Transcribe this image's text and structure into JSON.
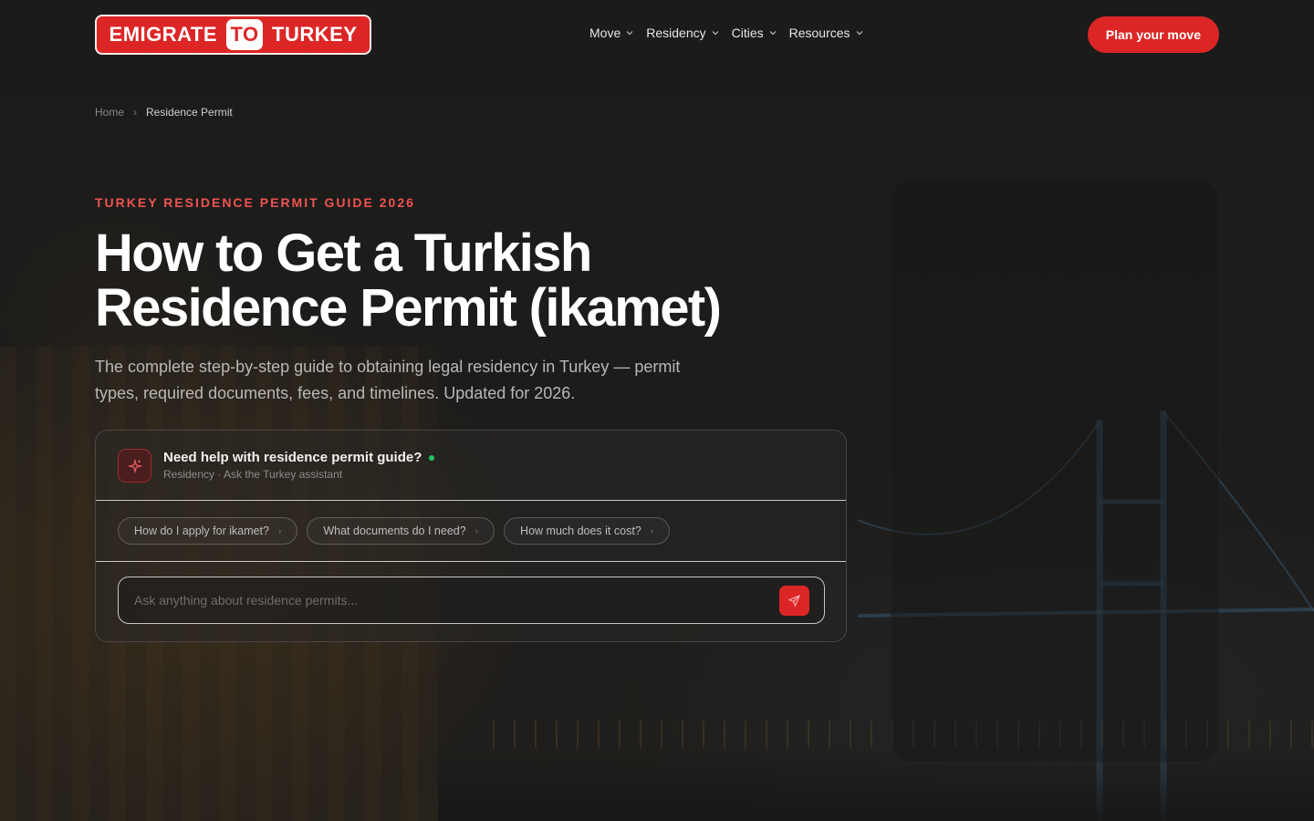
{
  "brand": {
    "left": "EMIGRATE",
    "middle": "TO",
    "right": "TURKEY"
  },
  "nav": {
    "items": [
      {
        "label": "Move"
      },
      {
        "label": "Residency"
      },
      {
        "label": "Cities"
      },
      {
        "label": "Resources"
      }
    ],
    "cta": "Plan your move"
  },
  "breadcrumb": {
    "home": "Home",
    "current": "Residence Permit"
  },
  "hero": {
    "eyebrow": "TURKEY RESIDENCE PERMIT GUIDE 2026",
    "title": "How to Get a Turkish Residence Permit (ikamet)",
    "subtitle": "The complete step-by-step guide to obtaining legal residency in Turkey — permit types, required documents, fees, and timelines. Updated for 2026."
  },
  "assistant": {
    "title": "Need help with residence permit guide?",
    "subtitle": "Residency · Ask the Turkey assistant",
    "suggestions": [
      {
        "label": "How do I apply for ikamet?"
      },
      {
        "label": "What documents do I need?"
      },
      {
        "label": "How much does it cost?"
      }
    ],
    "input_placeholder": "Ask anything about residence permits...",
    "input_value": ""
  },
  "colors": {
    "accent": "#dc2626",
    "online": "#22c55e",
    "eyebrow": "#ef5350"
  },
  "icons": {
    "assistant": "sparkle-icon",
    "send": "send-icon",
    "chevron": "chevron-down-icon"
  }
}
